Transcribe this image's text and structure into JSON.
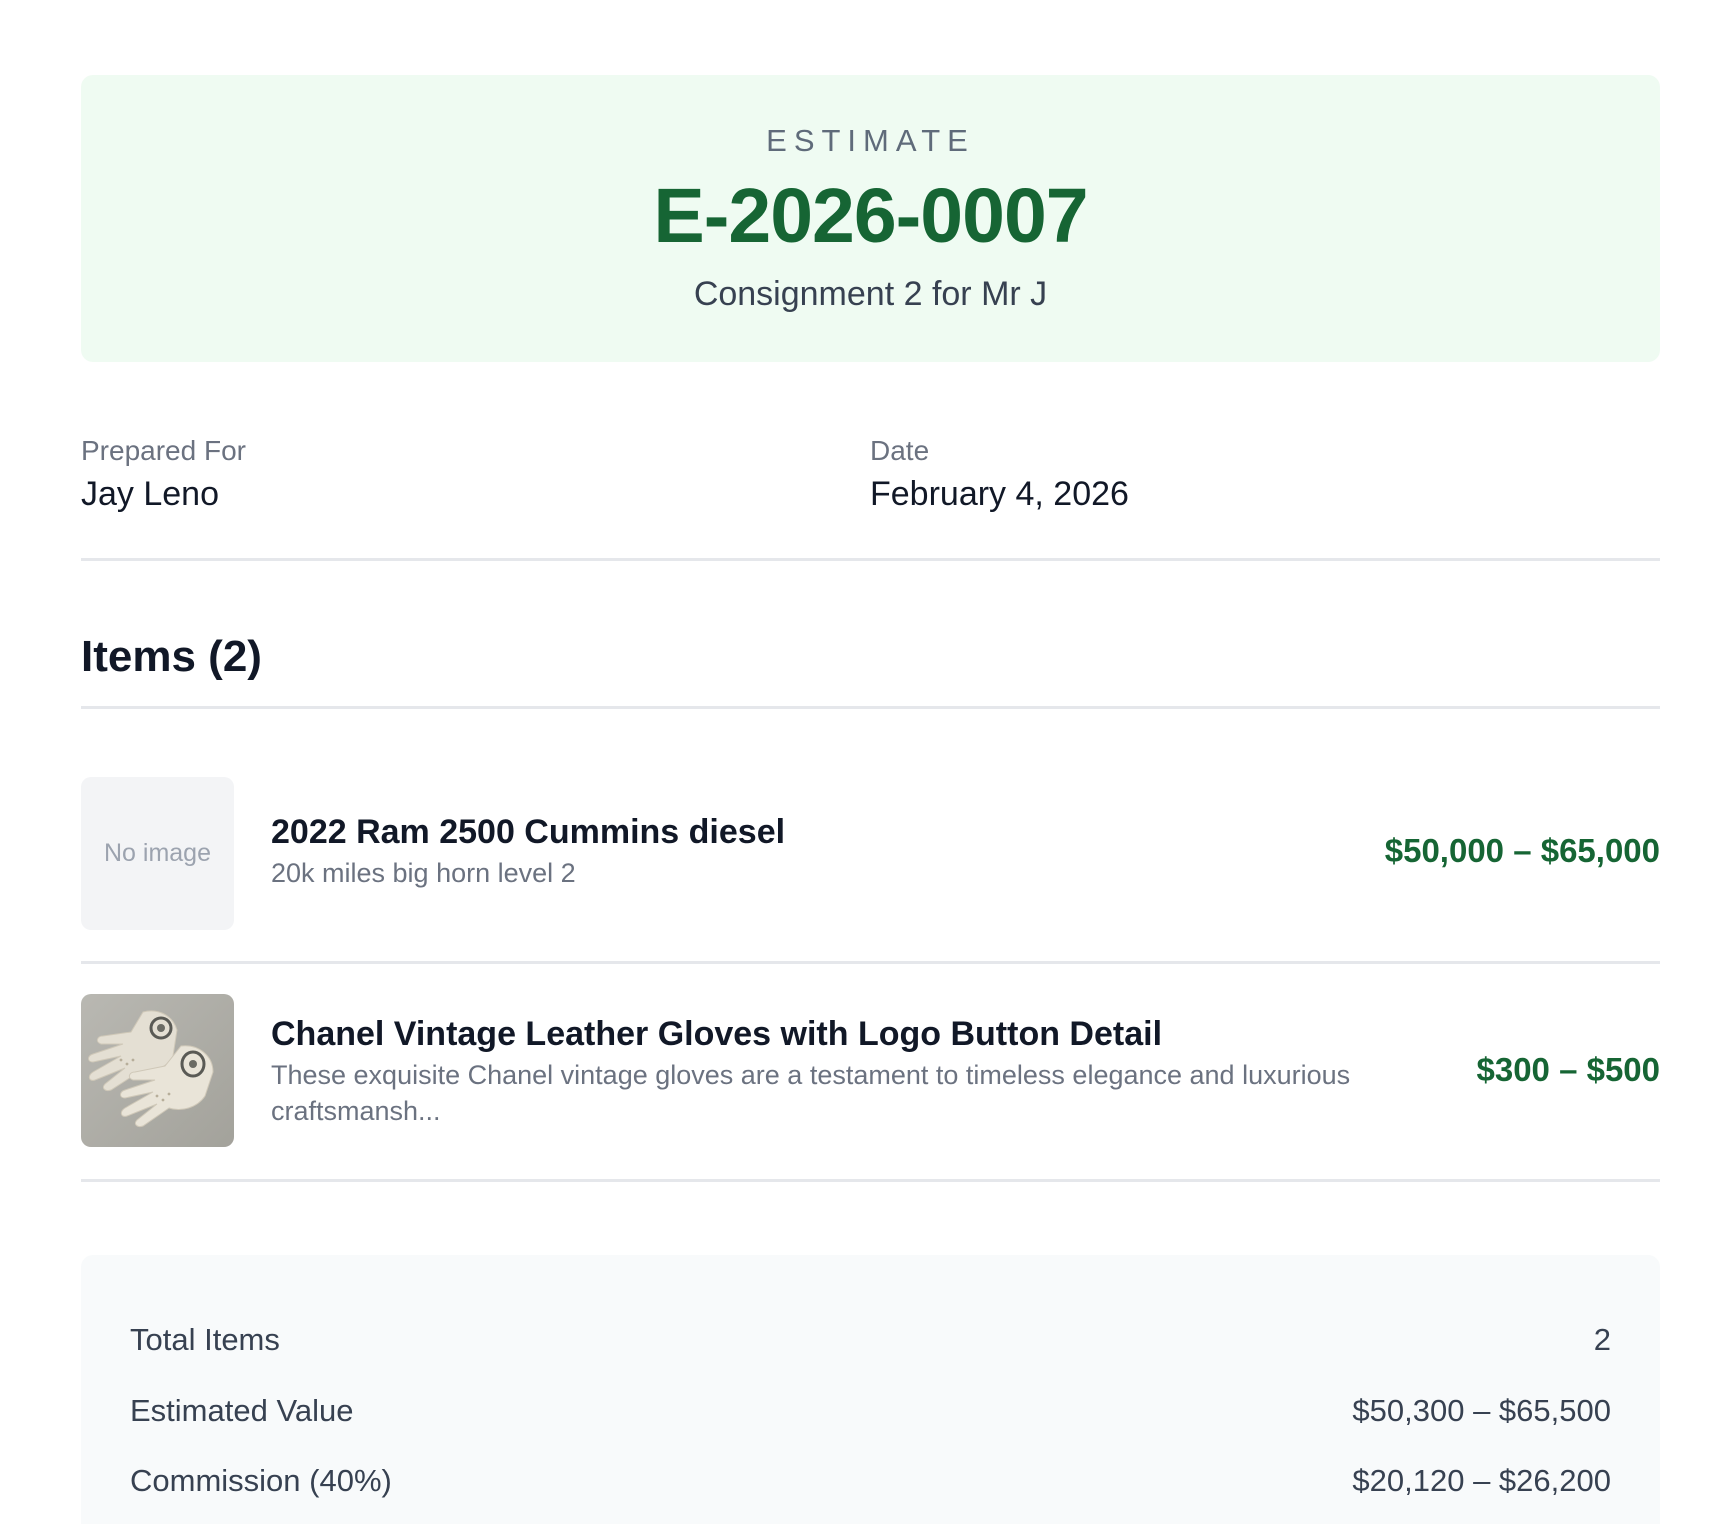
{
  "header": {
    "eyebrow": "ESTIMATE",
    "number": "E-2026-0007",
    "subtitle": "Consignment 2 for Mr J",
    "accent_color": "#166534",
    "background_color": "#effbf2"
  },
  "meta": {
    "prepared_for_label": "Prepared For",
    "prepared_for_value": "Jay Leno",
    "date_label": "Date",
    "date_value": "February 4, 2026"
  },
  "items_section": {
    "heading": "Items (2)",
    "items": [
      {
        "image": "No image",
        "title": "2022 Ram 2500 Cummins diesel",
        "description": "20k miles big horn level 2",
        "price": "$50,000 – $65,000"
      },
      {
        "image": "gloves-photo",
        "title": "Chanel Vintage Leather Gloves with Logo Button Detail",
        "description": "These exquisite Chanel vintage gloves are a testament to timeless elegance and luxurious craftsmansh...",
        "price": "$300 – $500"
      }
    ]
  },
  "summary": {
    "rows": [
      {
        "label": "Total Items",
        "value": "2"
      },
      {
        "label": "Estimated Value",
        "value": "$50,300 – $65,500"
      },
      {
        "label": "Commission (40%)",
        "value": "$20,120 – $26,200"
      }
    ]
  }
}
